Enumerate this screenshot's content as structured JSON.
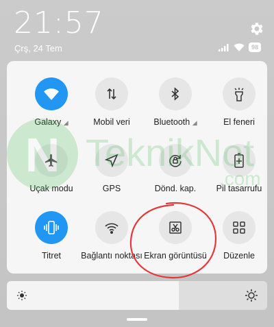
{
  "status_bar": {
    "time": "21:57",
    "date": "Çrş, 24 Tem",
    "battery": "98",
    "icons": [
      "signal-icon",
      "wifi-icon",
      "battery-icon"
    ]
  },
  "settings_icon": "gear-icon",
  "tiles": [
    {
      "label": "Galaxy",
      "icon": "wifi-icon",
      "active": true,
      "expand": true
    },
    {
      "label": "Mobil veri",
      "icon": "mobile-data-icon",
      "active": false
    },
    {
      "label": "Bluetooth",
      "icon": "bluetooth-icon",
      "active": false,
      "expand": true
    },
    {
      "label": "El feneri",
      "icon": "flashlight-icon",
      "active": false
    },
    {
      "label": "Uçak modu",
      "icon": "airplane-icon",
      "active": false
    },
    {
      "label": "GPS",
      "icon": "location-icon",
      "active": false
    },
    {
      "label": "Dönd. kap.",
      "icon": "rotation-lock-icon",
      "active": false
    },
    {
      "label": "Pil tasarrufu",
      "icon": "battery-saver-icon",
      "active": false
    },
    {
      "label": "Titret",
      "icon": "vibrate-icon",
      "active": true
    },
    {
      "label": "Bağlantı noktası",
      "icon": "hotspot-icon",
      "active": false
    },
    {
      "label": "Ekran görüntüsü",
      "icon": "screenshot-icon",
      "active": false
    },
    {
      "label": "Düzenle",
      "icon": "edit-grid-icon",
      "active": false
    }
  ],
  "brightness": {
    "level": 0.66,
    "icons": [
      "brightness-low-icon",
      "brightness-high-icon"
    ]
  },
  "watermark": {
    "text": "TeknikNot",
    "suffix": ".com"
  },
  "colors": {
    "accent": "#2196f3",
    "annotation": "#e5383b",
    "watermark": "#3cb94a"
  }
}
